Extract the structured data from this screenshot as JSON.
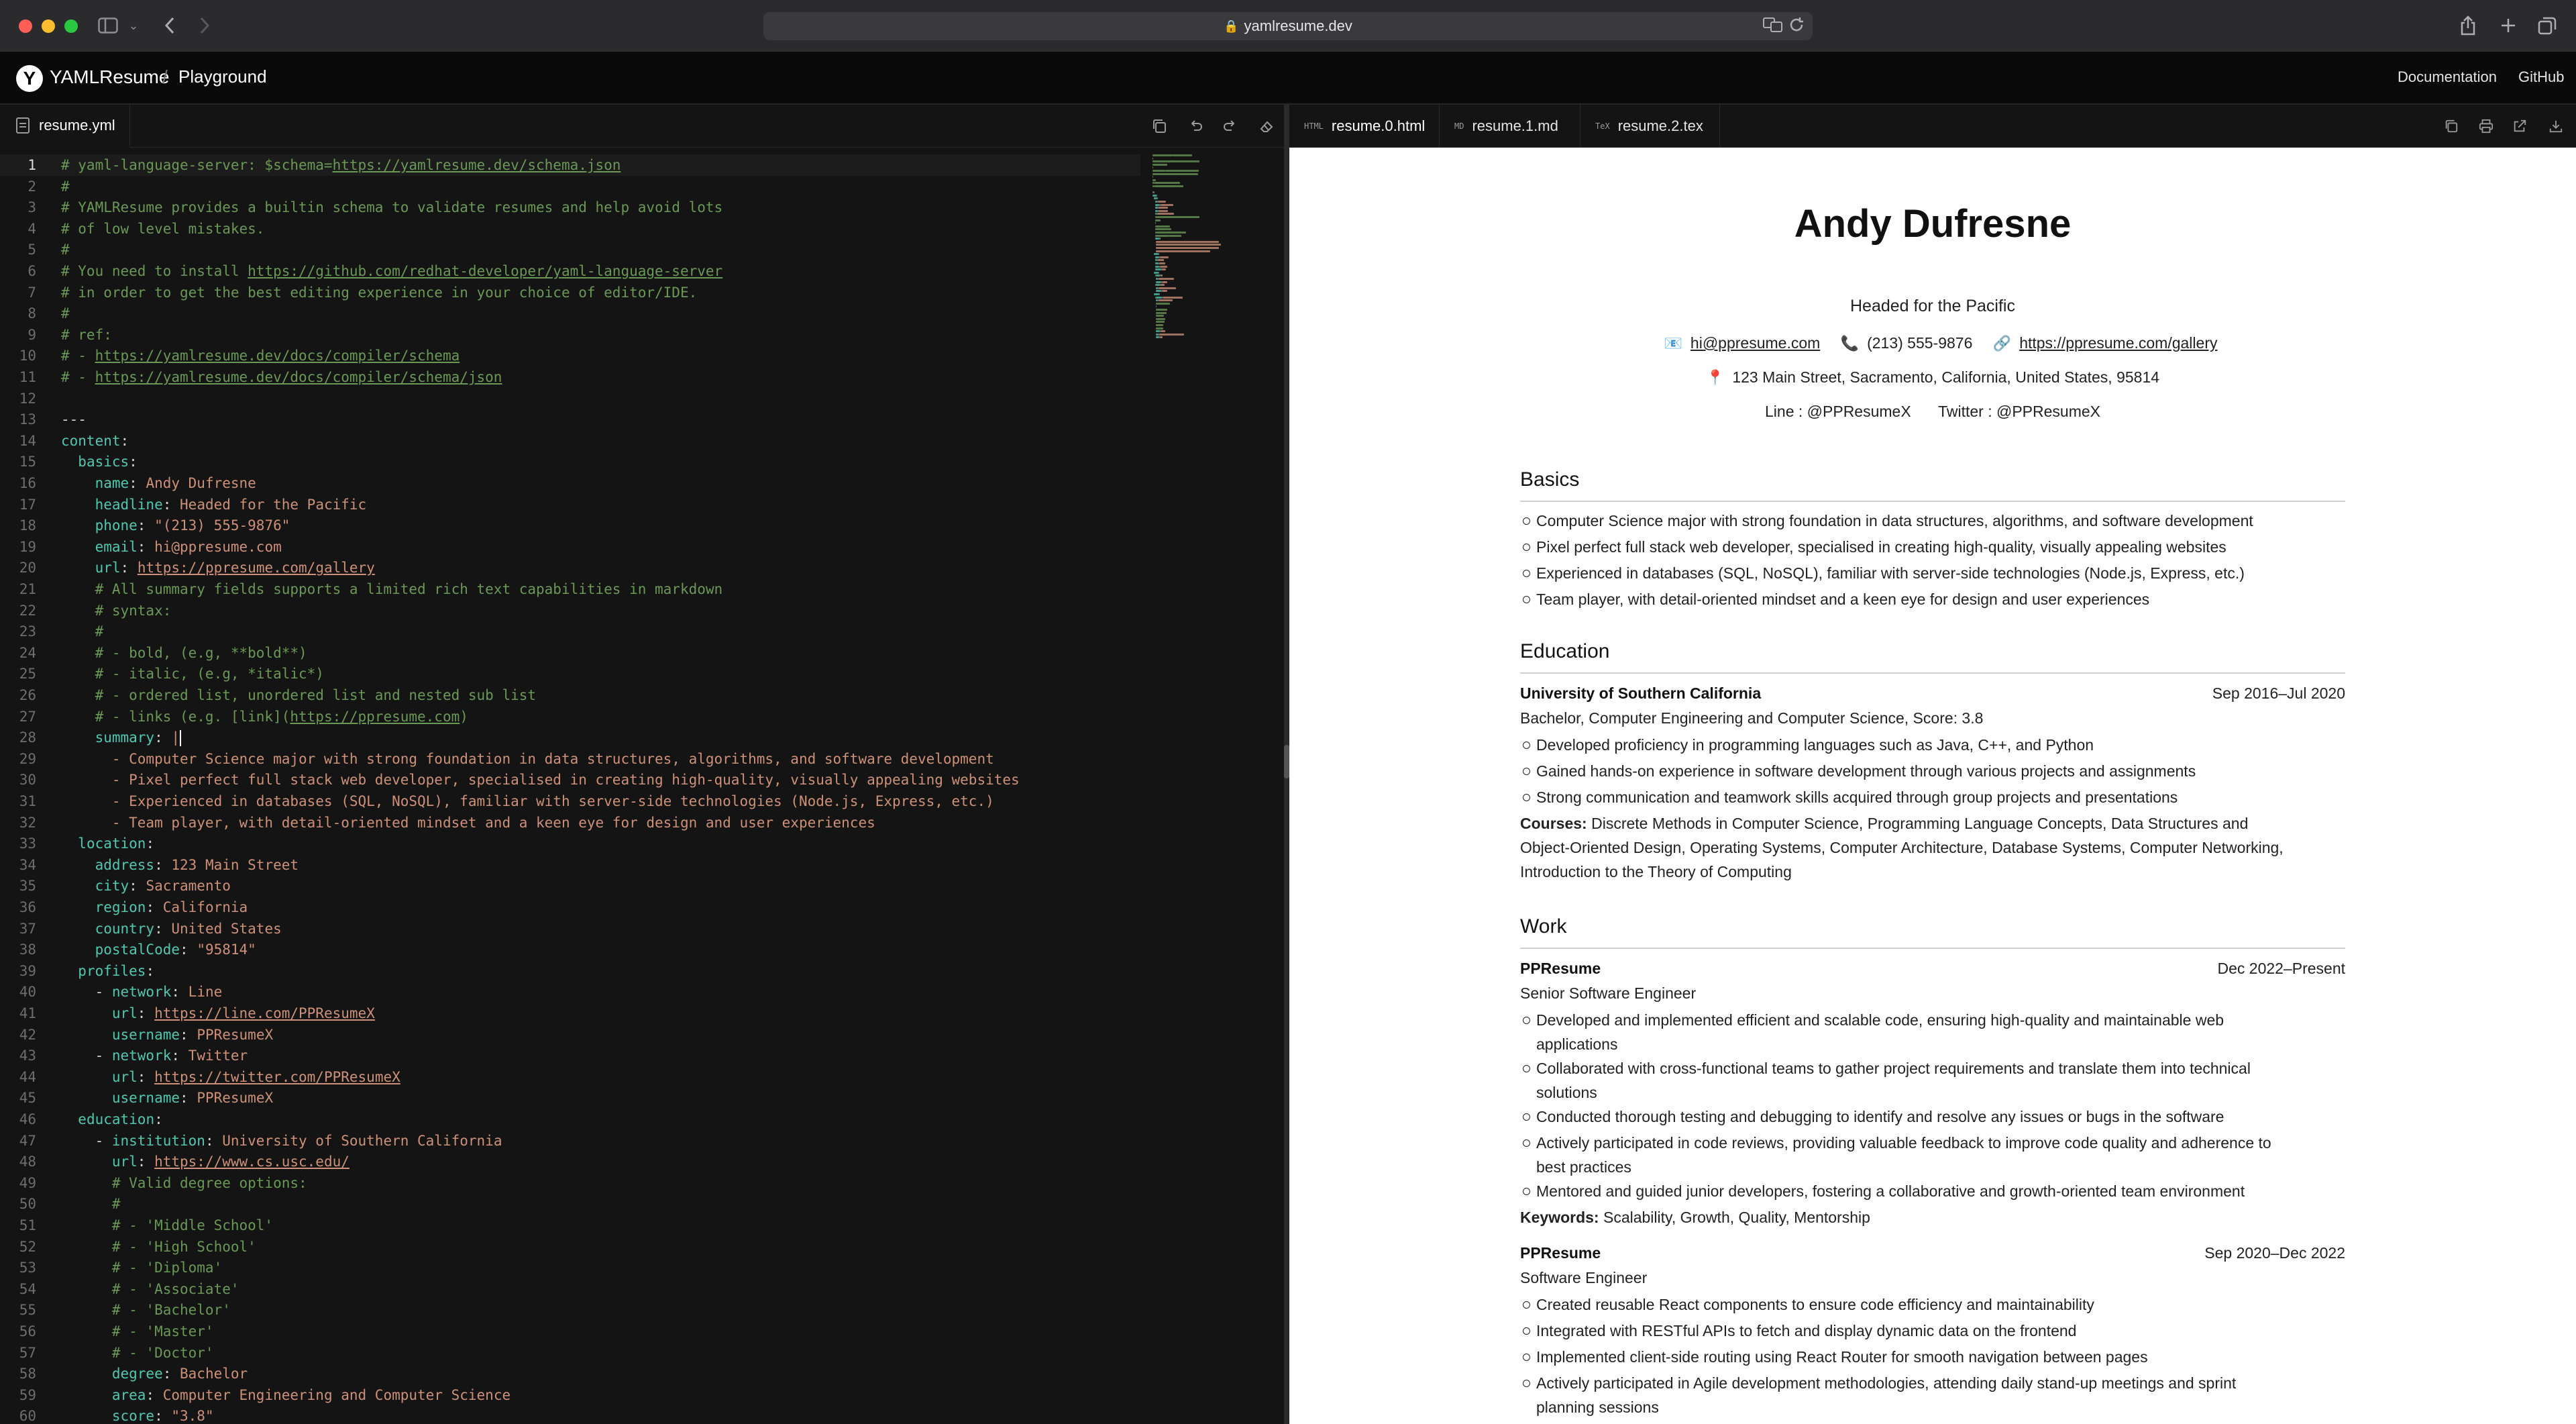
{
  "browser": {
    "url": "yamlresume.dev"
  },
  "app": {
    "brand": "YAMLResume",
    "separator": "/",
    "page": "Playground",
    "nav": [
      "Documentation",
      "GitHub"
    ]
  },
  "editor": {
    "tab_label": "resume.yml",
    "lines": [
      [
        [
          "c",
          "# yaml-language-server: $schema="
        ],
        [
          "cl",
          "https://yamlresume.dev/schema.json"
        ]
      ],
      [
        [
          "c",
          "#"
        ]
      ],
      [
        [
          "c",
          "# YAMLResume provides a builtin schema to validate resumes and help avoid lots"
        ]
      ],
      [
        [
          "c",
          "# of low level mistakes."
        ]
      ],
      [
        [
          "c",
          "#"
        ]
      ],
      [
        [
          "c",
          "# You need to install "
        ],
        [
          "cl",
          "https://github.com/redhat-developer/yaml-language-server"
        ]
      ],
      [
        [
          "c",
          "# in order to get the best editing experience in your choice of editor/IDE."
        ]
      ],
      [
        [
          "c",
          "#"
        ]
      ],
      [
        [
          "c",
          "# ref:"
        ]
      ],
      [
        [
          "c",
          "# - "
        ],
        [
          "cl",
          "https://yamlresume.dev/docs/compiler/schema"
        ]
      ],
      [
        [
          "c",
          "# - "
        ],
        [
          "cl",
          "https://yamlresume.dev/docs/compiler/schema/json"
        ]
      ],
      [],
      [
        [
          "p",
          "---"
        ]
      ],
      [
        [
          "k",
          "content"
        ],
        [
          "p",
          ":"
        ]
      ],
      [
        [
          "p",
          "  "
        ],
        [
          "k",
          "basics"
        ],
        [
          "p",
          ":"
        ]
      ],
      [
        [
          "p",
          "    "
        ],
        [
          "k",
          "name"
        ],
        [
          "p",
          ": "
        ],
        [
          "v",
          "Andy Dufresne"
        ]
      ],
      [
        [
          "p",
          "    "
        ],
        [
          "k",
          "headline"
        ],
        [
          "p",
          ": "
        ],
        [
          "v",
          "Headed for the Pacific"
        ]
      ],
      [
        [
          "p",
          "    "
        ],
        [
          "k",
          "phone"
        ],
        [
          "p",
          ": "
        ],
        [
          "v",
          "\"(213) 555-9876\""
        ]
      ],
      [
        [
          "p",
          "    "
        ],
        [
          "k",
          "email"
        ],
        [
          "p",
          ": "
        ],
        [
          "v",
          "hi@ppresume.com"
        ]
      ],
      [
        [
          "p",
          "    "
        ],
        [
          "k",
          "url"
        ],
        [
          "p",
          ": "
        ],
        [
          "u",
          "https://ppresume.com/gallery"
        ]
      ],
      [
        [
          "c",
          "    # All summary fields supports a limited rich text capabilities in markdown"
        ]
      ],
      [
        [
          "c",
          "    # syntax:"
        ]
      ],
      [
        [
          "c",
          "    #"
        ]
      ],
      [
        [
          "c",
          "    # - bold, (e.g, **bold**)"
        ]
      ],
      [
        [
          "c",
          "    # - italic, (e.g, *italic*)"
        ]
      ],
      [
        [
          "c",
          "    # - ordered list, unordered list and nested sub list"
        ]
      ],
      [
        [
          "c",
          "    # - links (e.g. [link]("
        ],
        [
          "cl",
          "https://ppresume.com"
        ],
        [
          "c",
          ")"
        ]
      ],
      [
        [
          "p",
          "    "
        ],
        [
          "k",
          "summary"
        ],
        [
          "p",
          ": "
        ],
        [
          "v",
          "|"
        ]
      ],
      [
        [
          "p",
          "      "
        ],
        [
          "v",
          "- Computer Science major with strong foundation in data structures, algorithms, and software development"
        ]
      ],
      [
        [
          "p",
          "      "
        ],
        [
          "v",
          "- Pixel perfect full stack web developer, specialised in creating high-quality, visually appealing websites"
        ]
      ],
      [
        [
          "p",
          "      "
        ],
        [
          "v",
          "- Experienced in databases (SQL, NoSQL), familiar with server-side technologies (Node.js, Express, etc.)"
        ]
      ],
      [
        [
          "p",
          "      "
        ],
        [
          "v",
          "- Team player, with detail-oriented mindset and a keen eye for design and user experiences"
        ]
      ],
      [
        [
          "p",
          "  "
        ],
        [
          "k",
          "location"
        ],
        [
          "p",
          ":"
        ]
      ],
      [
        [
          "p",
          "    "
        ],
        [
          "k",
          "address"
        ],
        [
          "p",
          ": "
        ],
        [
          "v",
          "123 Main Street"
        ]
      ],
      [
        [
          "p",
          "    "
        ],
        [
          "k",
          "city"
        ],
        [
          "p",
          ": "
        ],
        [
          "v",
          "Sacramento"
        ]
      ],
      [
        [
          "p",
          "    "
        ],
        [
          "k",
          "region"
        ],
        [
          "p",
          ": "
        ],
        [
          "v",
          "California"
        ]
      ],
      [
        [
          "p",
          "    "
        ],
        [
          "k",
          "country"
        ],
        [
          "p",
          ": "
        ],
        [
          "v",
          "United States"
        ]
      ],
      [
        [
          "p",
          "    "
        ],
        [
          "k",
          "postalCode"
        ],
        [
          "p",
          ": "
        ],
        [
          "v",
          "\"95814\""
        ]
      ],
      [
        [
          "p",
          "  "
        ],
        [
          "k",
          "profiles"
        ],
        [
          "p",
          ":"
        ]
      ],
      [
        [
          "p",
          "    - "
        ],
        [
          "k",
          "network"
        ],
        [
          "p",
          ": "
        ],
        [
          "v",
          "Line"
        ]
      ],
      [
        [
          "p",
          "      "
        ],
        [
          "k",
          "url"
        ],
        [
          "p",
          ": "
        ],
        [
          "u",
          "https://line.com/PPResumeX"
        ]
      ],
      [
        [
          "p",
          "      "
        ],
        [
          "k",
          "username"
        ],
        [
          "p",
          ": "
        ],
        [
          "v",
          "PPResumeX"
        ]
      ],
      [
        [
          "p",
          "    - "
        ],
        [
          "k",
          "network"
        ],
        [
          "p",
          ": "
        ],
        [
          "v",
          "Twitter"
        ]
      ],
      [
        [
          "p",
          "      "
        ],
        [
          "k",
          "url"
        ],
        [
          "p",
          ": "
        ],
        [
          "u",
          "https://twitter.com/PPResumeX"
        ]
      ],
      [
        [
          "p",
          "      "
        ],
        [
          "k",
          "username"
        ],
        [
          "p",
          ": "
        ],
        [
          "v",
          "PPResumeX"
        ]
      ],
      [
        [
          "p",
          "  "
        ],
        [
          "k",
          "education"
        ],
        [
          "p",
          ":"
        ]
      ],
      [
        [
          "p",
          "    - "
        ],
        [
          "k",
          "institution"
        ],
        [
          "p",
          ": "
        ],
        [
          "v",
          "University of Southern California"
        ]
      ],
      [
        [
          "p",
          "      "
        ],
        [
          "k",
          "url"
        ],
        [
          "p",
          ": "
        ],
        [
          "u",
          "https://www.cs.usc.edu/"
        ]
      ],
      [
        [
          "c",
          "      # Valid degree options:"
        ]
      ],
      [
        [
          "c",
          "      #"
        ]
      ],
      [
        [
          "c",
          "      # - 'Middle School'"
        ]
      ],
      [
        [
          "c",
          "      # - 'High School'"
        ]
      ],
      [
        [
          "c",
          "      # - 'Diploma'"
        ]
      ],
      [
        [
          "c",
          "      # - 'Associate'"
        ]
      ],
      [
        [
          "c",
          "      # - 'Bachelor'"
        ]
      ],
      [
        [
          "c",
          "      # - 'Master'"
        ]
      ],
      [
        [
          "c",
          "      # - 'Doctor'"
        ]
      ],
      [
        [
          "p",
          "      "
        ],
        [
          "k",
          "degree"
        ],
        [
          "p",
          ": "
        ],
        [
          "v",
          "Bachelor"
        ]
      ],
      [
        [
          "p",
          "      "
        ],
        [
          "k",
          "area"
        ],
        [
          "p",
          ": "
        ],
        [
          "v",
          "Computer Engineering and Computer Science"
        ]
      ],
      [
        [
          "p",
          "      "
        ],
        [
          "k",
          "score"
        ],
        [
          "p",
          ": "
        ],
        [
          "v",
          "\"3.8\""
        ]
      ]
    ]
  },
  "preview": {
    "tabs": [
      "resume.0.html",
      "resume.1.md",
      "resume.2.tex"
    ],
    "tab_icons": [
      "HTML",
      "MD",
      "TeX"
    ],
    "resume": {
      "name": "Andy Dufresne",
      "headline": "Headed for the Pacific",
      "email": "hi@ppresume.com",
      "phone": "(213) 555-9876",
      "url": "https://ppresume.com/gallery",
      "location": "123 Main Street, Sacramento, California, United States, 95814",
      "profiles": [
        {
          "network": "Line",
          "username": ": @PPResumeX"
        },
        {
          "network": "Twitter",
          "username": ": @PPResumeX"
        }
      ],
      "sections": {
        "basics": "Basics",
        "education": "Education",
        "work": "Work"
      },
      "summary": [
        "Computer Science major with strong foundation in data structures, algorithms, and software development",
        "Pixel perfect full stack web developer, specialised in creating high-quality, visually appealing websites",
        "Experienced in databases (SQL, NoSQL), familiar with server-side technologies (Node.js, Express, etc.)",
        "Team player, with detail-oriented mindset and a keen eye for design and user experiences"
      ],
      "education": {
        "institution": "University of Southern California",
        "dates": "Sep 2016–Jul 2020",
        "degree_line": "Bachelor, Computer Engineering and Computer Science, Score: 3.8",
        "bullets": [
          "Developed proficiency in programming languages such as Java, C++, and Python",
          "Gained hands-on experience in software development through various projects and assignments",
          "Strong communication and teamwork skills acquired through group projects and presentations"
        ],
        "courses_label": "Courses:",
        "courses_line1": " Discrete Methods in Computer Science, Programming Language Concepts, Data Structures and",
        "courses_line2": "Object-Oriented Design, Operating Systems, Computer Architecture, Database Systems, Computer Networking,",
        "courses_line3": "Introduction to the Theory of Computing"
      },
      "work": [
        {
          "company": "PPResume",
          "dates": "Dec 2022–Present",
          "position": "Senior Software Engineer",
          "bullets": [
            [
              "Developed and implemented efficient and scalable code, ensuring high-quality and maintainable web",
              "applications"
            ],
            [
              "Collaborated with cross-functional teams to gather project requirements and translate them into technical",
              "solutions"
            ],
            [
              "Conducted thorough testing and debugging to identify and resolve any issues or bugs in the software"
            ],
            [
              "Actively participated in code reviews, providing valuable feedback to improve code quality and adherence to",
              "best practices"
            ],
            [
              "Mentored and guided junior developers, fostering a collaborative and growth-oriented team environment"
            ]
          ],
          "keywords_label": "Keywords:",
          "keywords": " Scalability, Growth, Quality, Mentorship"
        },
        {
          "company": "PPResume",
          "dates": "Sep 2020–Dec 2022",
          "position": "Software Engineer",
          "bullets": [
            [
              "Created reusable React components to ensure code efficiency and maintainability"
            ],
            [
              "Integrated with RESTful APIs to fetch and display dynamic data on the frontend"
            ],
            [
              "Implemented client-side routing using React Router for smooth navigation between pages"
            ],
            [
              "Actively participated in Agile development methodologies, attending daily stand-up meetings and sprint",
              "planning sessions"
            ]
          ]
        }
      ]
    }
  },
  "colors": {
    "comment": "#6a9955",
    "key": "#4ec9b0",
    "value": "#ce9178",
    "editor_bg": "#141414",
    "preview_bg": "#ffffff"
  }
}
